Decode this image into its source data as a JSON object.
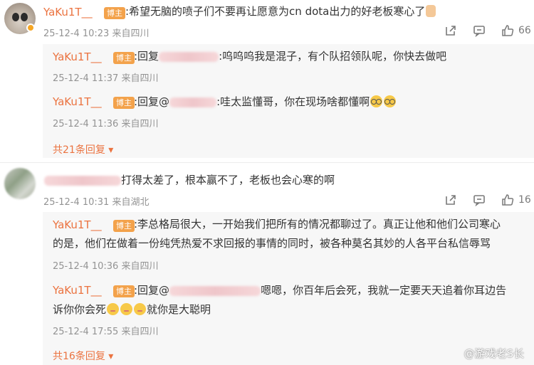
{
  "comments": [
    {
      "author": "YaKu1T__",
      "tag": "博主",
      "text": ":希望无脑的喷子们不要再让愿意为cn dota出力的好老板寒心了",
      "time": "25-12-4 10:23 来自四川",
      "likes": "66",
      "replies": [
        {
          "author": "YaKu1T__",
          "tag": "博主",
          "prefix": ":回复",
          "text": ":呜呜呜我是混子，有个队招领队呢，你快去做吧",
          "time": "25-12-4 11:37 来自四川"
        },
        {
          "author": "YaKu1T__",
          "tag": "博主",
          "prefix": ":回复@",
          "text": ":哇太监懂哥，你在现场啥都懂啊",
          "time": "25-12-4 11:36 来自四川"
        }
      ],
      "more": "共21条回复"
    },
    {
      "text": "打得太差了，根本赢不了，老板也会心寒的啊",
      "time": "25-12-4 10:31 来自湖北",
      "likes": "16",
      "replies": [
        {
          "author": "YaKu1T__",
          "tag": "博主",
          "line1": ":李总格局很大，一开始我们把所有的情况都聊过了。真正让他和他们公司寒心",
          "line2": "的是，他们在做着一份纯凭热爱不求回报的事情的同时，被各种莫名其妙的人各平台私信辱骂",
          "time": "25-12-4 10:36 来自四川"
        },
        {
          "author": "YaKu1T__",
          "tag": "博主",
          "prefix": ":回复@",
          "line1": "嗯嗯，你百年后会死，我就一定要天天追着你耳边告",
          "line2a": "诉你你会死",
          "line2b": "就你是大聪明",
          "time": "25-12-4 17:55 来自四川"
        }
      ],
      "more": "共16条回复"
    }
  ],
  "watermark": "@游戏老S长",
  "colors": {
    "author": "#eb7340",
    "tag": "#f3a24b",
    "meta": "#939393",
    "reply_bg": "#f7f7f7"
  }
}
